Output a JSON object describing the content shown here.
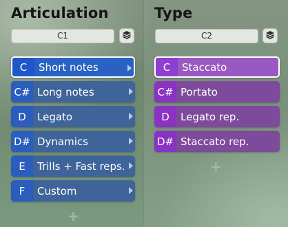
{
  "articulation": {
    "title": "Articulation",
    "selector_value": "C1",
    "items": [
      {
        "note": "C",
        "label": "Short notes",
        "selected": true
      },
      {
        "note": "C#",
        "label": "Long notes",
        "selected": false
      },
      {
        "note": "D",
        "label": "Legato",
        "selected": false
      },
      {
        "note": "D#",
        "label": "Dynamics",
        "selected": false
      },
      {
        "note": "E",
        "label": "Trills + Fast reps.",
        "selected": false
      },
      {
        "note": "F",
        "label": "Custom",
        "selected": false
      }
    ],
    "add_label": "+"
  },
  "type": {
    "title": "Type",
    "selector_value": "C2",
    "items": [
      {
        "note": "C",
        "label": "Staccato",
        "selected": true
      },
      {
        "note": "C#",
        "label": "Portato",
        "selected": false
      },
      {
        "note": "D",
        "label": "Legato rep.",
        "selected": false
      },
      {
        "note": "D#",
        "label": "Staccato rep.",
        "selected": false
      }
    ],
    "add_label": "+"
  },
  "icons": {
    "layers": "layers-icon",
    "submenu_arrow": "chevron-right-icon",
    "add": "plus-icon"
  },
  "colors": {
    "articulation_item": "#3e649a",
    "articulation_selected": "#2961c4",
    "type_item": "#7e4a9c",
    "type_selected": "#9a58c2"
  }
}
